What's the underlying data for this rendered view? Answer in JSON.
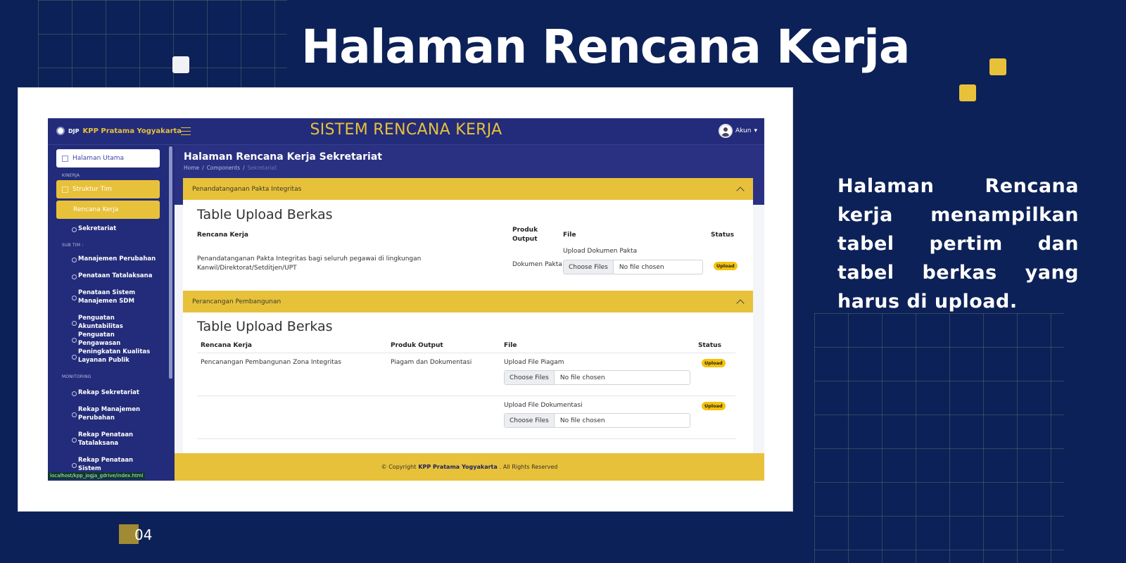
{
  "slide": {
    "title": "Halaman Rencana Kerja",
    "description": "Halaman Rencana kerja menampilkan tabel pertim dan tabel berkas yang harus di upload.",
    "page_number": "04",
    "colors": {
      "background": "#0c2157",
      "accent_gold": "#e8c13a",
      "panel_white": "#ffffff"
    }
  },
  "app": {
    "brand_mini": "DJP",
    "brand_name": "KPP Pratama Yogyakarta",
    "title": "SISTEM RENCANA KERJA",
    "account_label": "Akun",
    "colors": {
      "navy": "#232c7a",
      "gold": "#e8c13a"
    }
  },
  "sidebar": {
    "home": "Halaman Utama",
    "section_kinerja": "KINERJA",
    "struktur_tim": "Struktur Tim",
    "rencana_kerja": "Rencana Kerja",
    "sekretariat": "Sekretariat",
    "section_subtim": "SUB TIM :",
    "subtim_items": [
      "Manajemen Perubahan",
      "Penataan Tatalaksana",
      "Penataan Sistem Manajemen SDM",
      "Penguatan Akuntabilitas",
      "Penguatan Pengawasan",
      "Peningkatan Kualitas Layanan Publik"
    ],
    "section_monitoring": "MONITORING",
    "monitoring_items": [
      "Rekap Sekretariat",
      "Rekap Manajemen Perubahan",
      "Rekap Penataan Tatalaksana",
      "Rekap Penataan Sistem"
    ],
    "url_tip": "localhost/kpp_jogja_gdrive/index.html"
  },
  "main": {
    "heading": "Halaman Rencana Kerja Sekretariat",
    "breadcrumb": [
      "Home",
      "/",
      "Components",
      "/",
      "Sekretariat"
    ],
    "card1": {
      "header": "Penandatanganan Pakta Integritas",
      "table_title": "Table Upload Berkas",
      "columns": [
        "Rencana Kerja",
        "Produk Output",
        "File",
        "Status"
      ],
      "row": {
        "rencana": "Penandatanganan Pakta Integritas bagi seluruh pegawai di lingkungan Kanwil/Direktorat/Setditjen/UPT",
        "produk": "Dokumen Pakta",
        "file_label": "Upload Dokumen Pakta",
        "status": "Upload"
      }
    },
    "card2": {
      "header": "Perancangan Pembangunan",
      "table_title": "Table Upload Berkas",
      "columns": [
        "Rencana Kerja",
        "Produk Output",
        "File",
        "Status"
      ],
      "row": {
        "rencana": "Pencanangan Pembangunan Zona Integritas",
        "produk": "Piagam dan Dokumentasi",
        "file1_label": "Upload File Piagam",
        "file2_label": "Upload File Dokumentasi",
        "status": "Upload"
      }
    },
    "file_button": "Choose Files",
    "file_empty": "No file chosen"
  },
  "footer": {
    "prefix": "© Copyright",
    "brand": "KPP Pratama Yogyakarta",
    "suffix": ". All Rights Reserved"
  }
}
